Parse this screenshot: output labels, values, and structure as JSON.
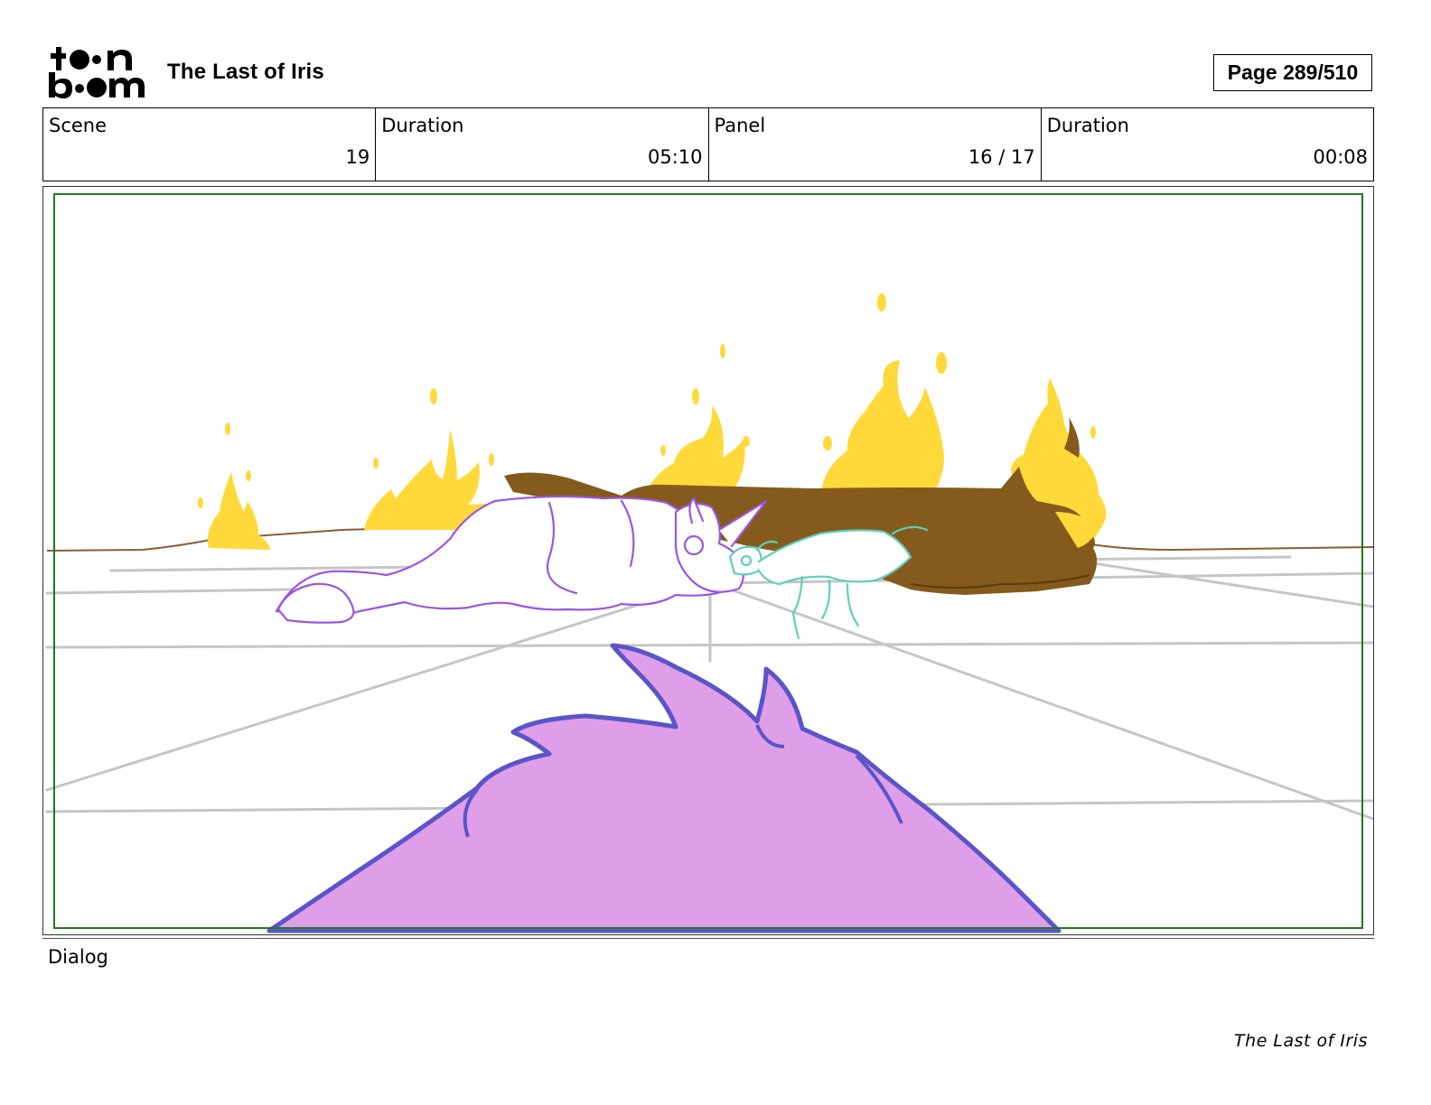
{
  "header": {
    "title": "The Last of Iris",
    "page_label": "Page 289/510",
    "logo_name": "toon-boom-logo"
  },
  "info": {
    "scene_label": "Scene",
    "scene_value": "19",
    "scene_duration_label": "Duration",
    "scene_duration_value": "05:10",
    "panel_label": "Panel",
    "panel_value": "16 / 17",
    "panel_duration_label": "Duration",
    "panel_duration_value": "00:08"
  },
  "panel": {
    "safe_frame_color": "#1e7a1e",
    "fire_color": "#ffd93a",
    "log_color": "#855b1d",
    "unicorn_line_color": "#9a55e6",
    "foal_line_color": "#5fcfb8",
    "foreground_fill": "#df9ee8",
    "foreground_line": "#5a55c8"
  },
  "dialog": {
    "label": "Dialog"
  },
  "footer": {
    "title": "The Last of Iris"
  }
}
